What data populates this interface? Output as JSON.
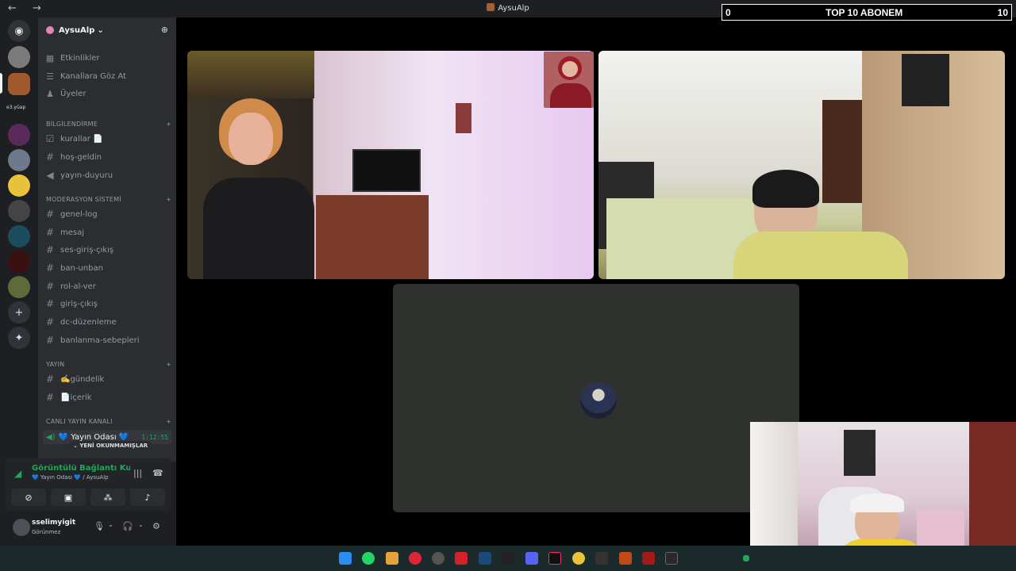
{
  "titlebar": {
    "nav_symbols": "← →",
    "title": "AysuAlp",
    "controls": [
      "▭",
      "?",
      "—",
      "☐",
      "✕"
    ]
  },
  "overlay": {
    "left_value": "0",
    "label": "TOP 10 ABONEM",
    "right_value": "10"
  },
  "guild": {
    "name": "AysuAlp",
    "chevron": "⌄"
  },
  "top_nav": [
    {
      "label": "Etkinlikler",
      "icon": "calendar-icon"
    },
    {
      "label": "Kanallara Göz At",
      "icon": "browse-icon"
    },
    {
      "label": "Üyeler",
      "icon": "members-icon"
    }
  ],
  "categories": {
    "info": {
      "label": "BİLGİLENDİRME",
      "channels": [
        "kurallar 📄",
        "hoş-geldin",
        "yayın-duyuru"
      ]
    },
    "moderation": {
      "label": "MODERASYON SİSTEMİ",
      "channels": [
        "genel-log",
        "mesaj",
        "ses-giriş-çıkış",
        "ban-unban",
        "rol-al-ver",
        "giriş-çıkış",
        "dc-düzenleme",
        "banlanma-sebepleri"
      ]
    },
    "stream": {
      "label": "YAYIN",
      "channels": [
        "✍️gündelik",
        "📄içerik"
      ]
    },
    "live": {
      "label": "CANLI YAYIN KANALI"
    }
  },
  "voice_channel": {
    "label": "💙 Yayın Odası 💙",
    "timer": "1:12:55"
  },
  "unread_pill": "YENİ OKUNMAMIŞLAR",
  "server_label": "e3.yüap",
  "voice_panel": {
    "status": "Görüntülü Bağlantı Kuruldu",
    "sub": "💙 Yayın Odası 💙 / AysuAlp"
  },
  "user": {
    "name": "sselimyigit",
    "status": "Görünmez"
  }
}
